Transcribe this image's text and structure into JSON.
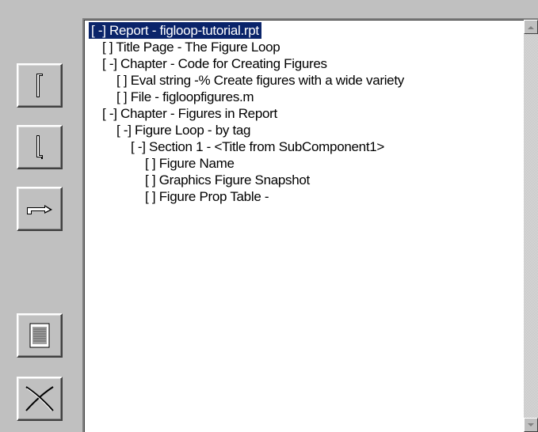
{
  "toolbar": {
    "buttons": [
      {
        "icon": "move-up-icon"
      },
      {
        "icon": "move-down-icon"
      },
      {
        "icon": "indent-icon"
      },
      {
        "icon": "properties-icon"
      },
      {
        "icon": "delete-icon"
      }
    ]
  },
  "tree": {
    "items": [
      {
        "label": "[ -] Report - figloop-tutorial.rpt",
        "level": 0,
        "selected": true
      },
      {
        "label": "[ ] Title Page - The Figure Loop",
        "level": 1
      },
      {
        "label": "[ -] Chapter - Code for Creating Figures",
        "level": 1
      },
      {
        "label": "[ ] Eval string -% Create figures with a wide variety",
        "level": 2
      },
      {
        "label": "[ ] File - figloopfigures.m",
        "level": 2
      },
      {
        "label": "[ -] Chapter - Figures in Report",
        "level": 1
      },
      {
        "label": "[ -] Figure Loop - by tag",
        "level": 2
      },
      {
        "label": "[ -] Section 1 - <Title from SubComponent1>",
        "level": 3
      },
      {
        "label": "[ ] Figure Name",
        "level": 4
      },
      {
        "label": "[ ] Graphics Figure Snapshot",
        "level": 4
      },
      {
        "label": "[ ] Figure Prop Table -",
        "level": 4
      }
    ]
  },
  "colors": {
    "selection": "#0a246a",
    "face": "#c0c0c0"
  }
}
